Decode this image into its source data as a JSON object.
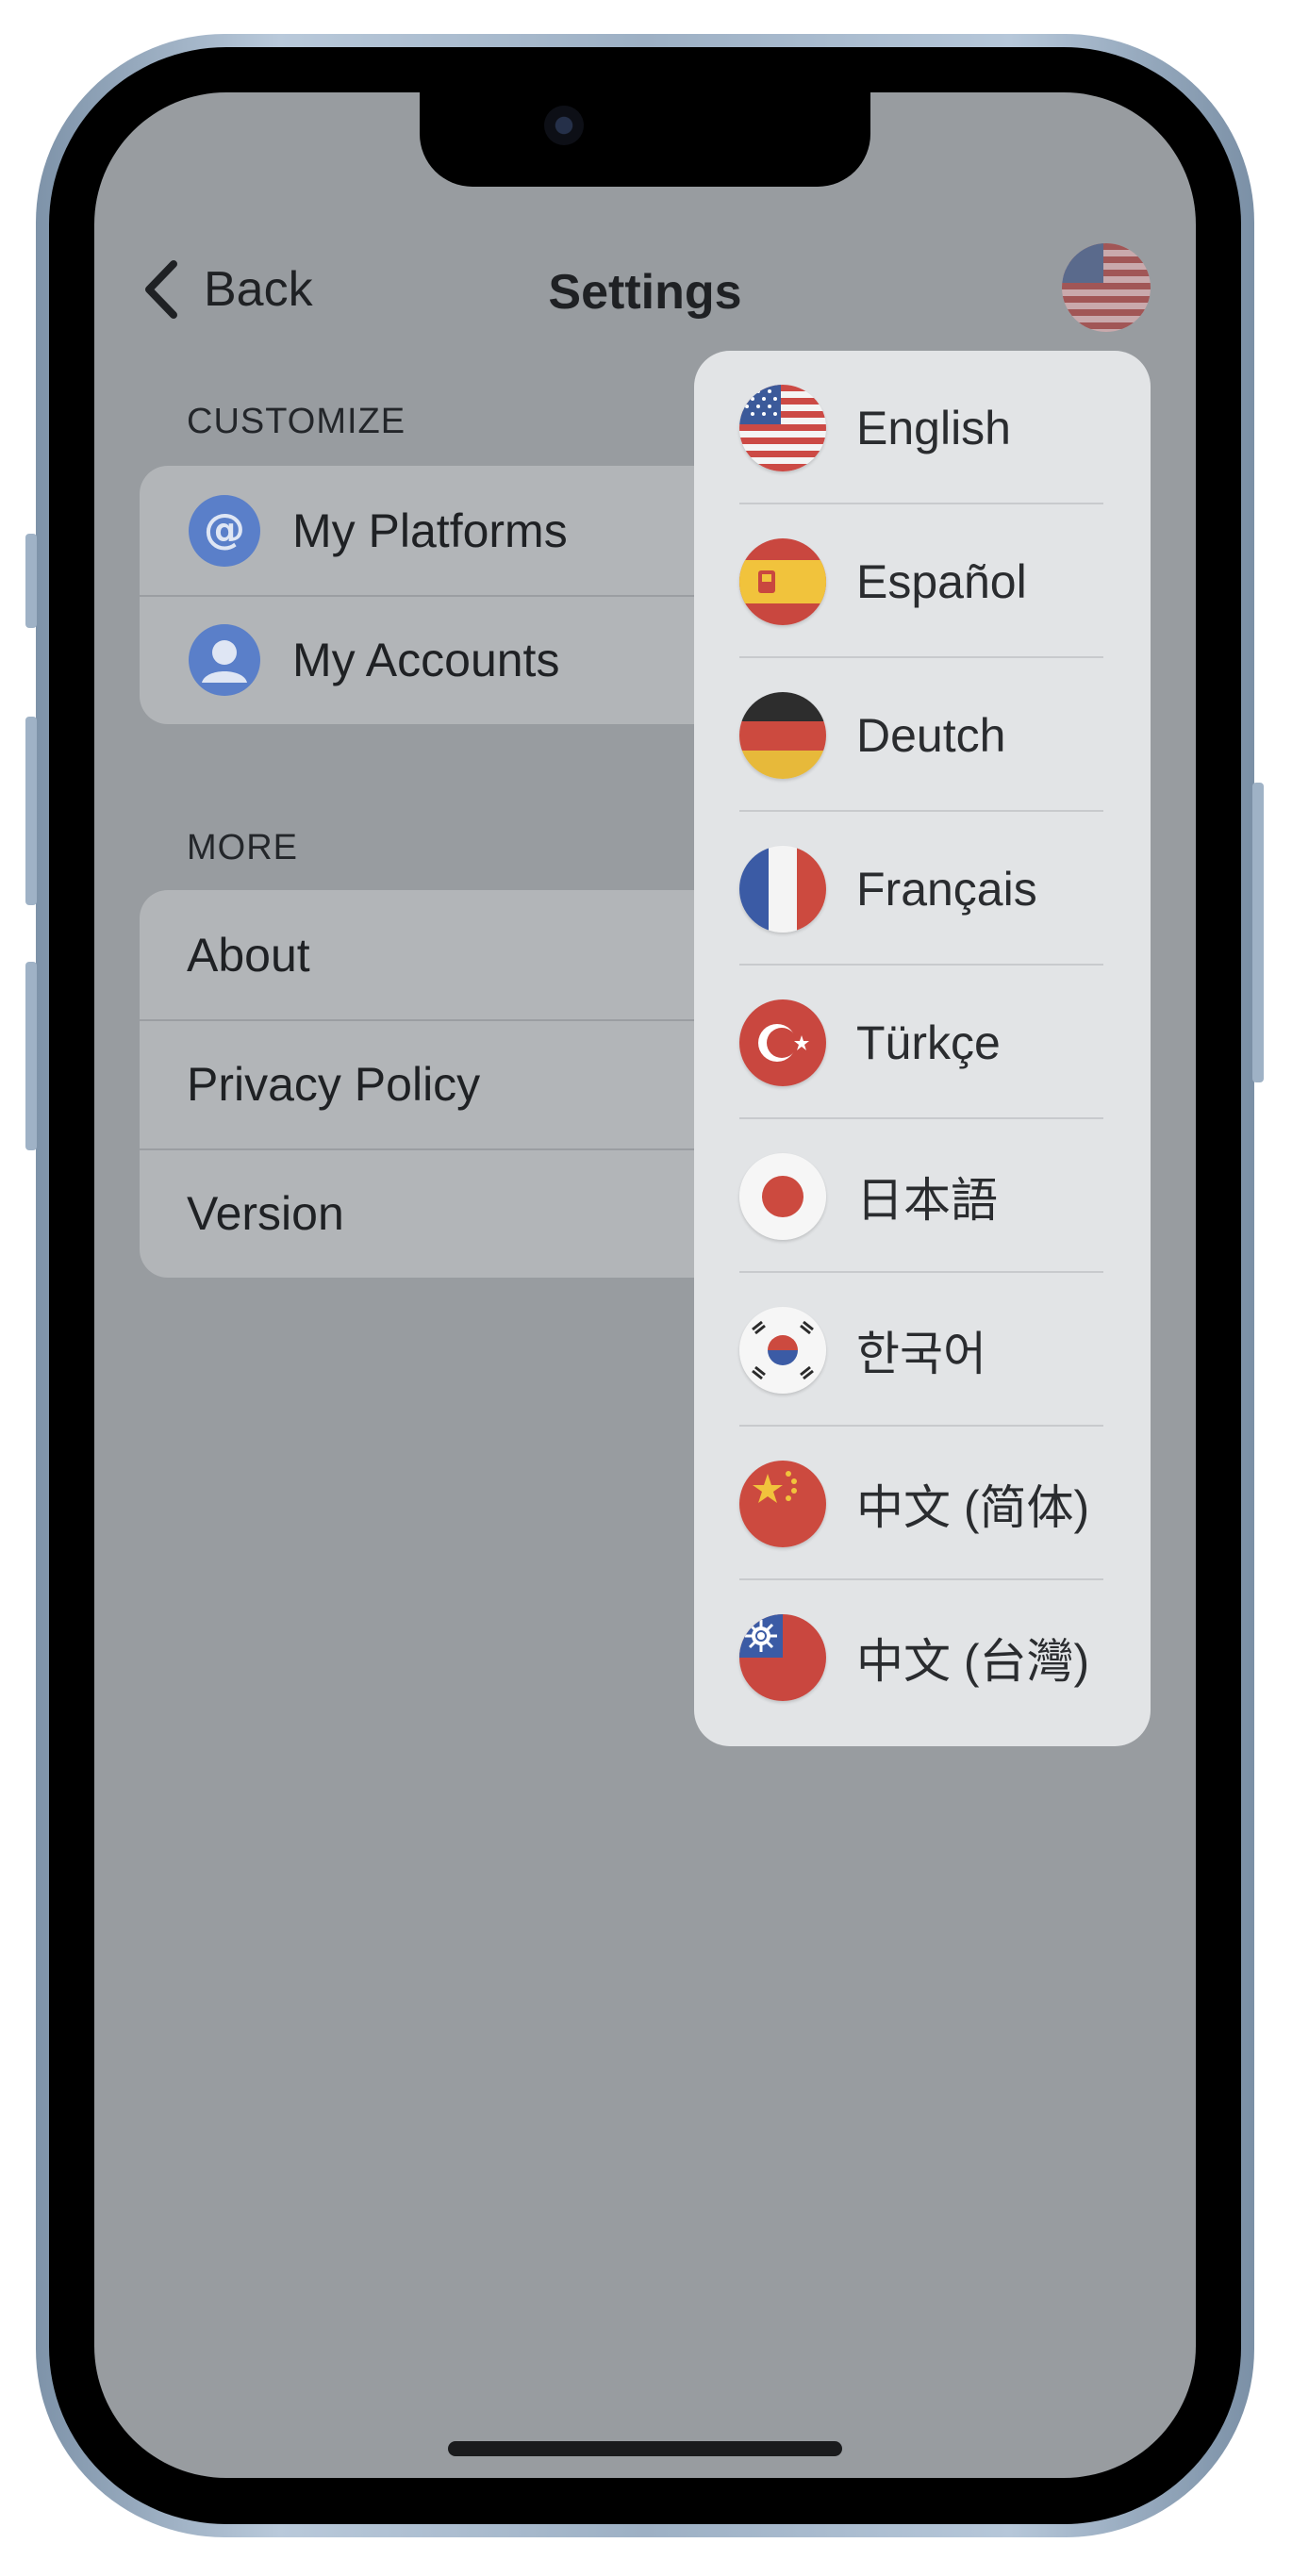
{
  "header": {
    "back_label": "Back",
    "title": "Settings",
    "language_flag_icon": "us-flag-icon"
  },
  "customize": {
    "section_label": "CUSTOMIZE",
    "items": [
      {
        "label": "My Platforms",
        "icon": "at-sign-icon"
      },
      {
        "label": "My Accounts",
        "icon": "person-icon"
      }
    ]
  },
  "more": {
    "section_label": "MORE",
    "items": [
      {
        "label": "About"
      },
      {
        "label": "Privacy Policy"
      },
      {
        "label": "Version"
      }
    ]
  },
  "language_menu": {
    "items": [
      {
        "label": "English",
        "icon": "us-flag-icon"
      },
      {
        "label": "Español",
        "icon": "spain-flag-icon"
      },
      {
        "label": "Deutch",
        "icon": "germany-flag-icon"
      },
      {
        "label": "Français",
        "icon": "france-flag-icon"
      },
      {
        "label": "Türkçe",
        "icon": "turkey-flag-icon"
      },
      {
        "label": "日本語",
        "icon": "japan-flag-icon"
      },
      {
        "label": "한국어",
        "icon": "korea-flag-icon"
      },
      {
        "label": "中文 (简体)",
        "icon": "china-flag-icon"
      },
      {
        "label": "中文 (台灣)",
        "icon": "taiwan-flag-icon"
      }
    ]
  },
  "colors": {
    "screen_dim": "#989ca0",
    "list_group": "#b2b5b8",
    "dropdown": "#e2e4e6",
    "icon_blue": "#5a7fc9",
    "frame": "#9fb2c6"
  }
}
